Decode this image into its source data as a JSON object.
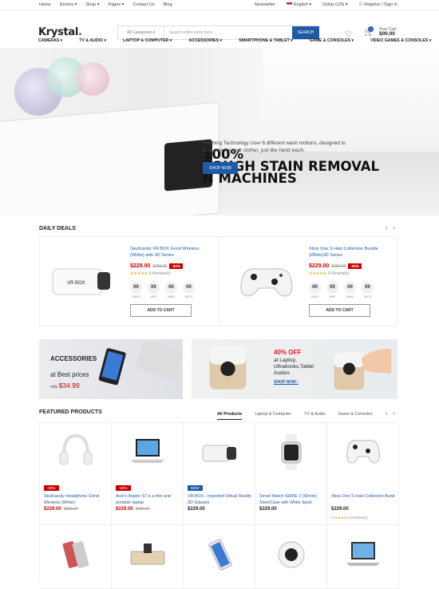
{
  "topbar": {
    "links": [
      "Home",
      "Demos ▾",
      "Shop ▾",
      "Pages ▾",
      "Contact Us",
      "Blog"
    ],
    "newsletter": "Newsletter",
    "language": "English ▾",
    "currency": "Dollar (US) ▾",
    "account": "Register / Sign in"
  },
  "header": {
    "logo": "Krystal",
    "category": "All Categories ▾",
    "search_placeholder": "Search entire store here...",
    "search_button": "SEARCH",
    "cart_label": "Your Cart:",
    "cart_total": "$00.00",
    "cart_count": "0"
  },
  "menu": [
    "CAMERAS ▾",
    "TV & AUDIO ▾",
    "LAPTOP & COMPUTER ▾",
    "ACCESSORIES ▾",
    "SMARTPHONE & TABLET ▾",
    "GAME & CONSOLES ▾",
    "VIDEO GAMES & CONSOLES ▾"
  ],
  "hero": {
    "line1": "100%",
    "line2": "TOUGH STAIN REMOVAL",
    "line3": "N MACHINES",
    "sub": "Washing Tachnology User 6 different wash motions, designed to best care for your clother, just like hand wash.",
    "button": "SHOP NOW"
  },
  "daily_deals": {
    "title": "DAILY DEALS",
    "items": [
      {
        "name": "Skullcandy VR BOX Grind Wireless (White) with 3D Series",
        "price": "$229.00",
        "old": "$280.00",
        "off": "-50%",
        "reviews": "5 Review(s)",
        "timer": [
          "00",
          "00",
          "00",
          "00"
        ],
        "units": [
          "DAYS",
          "HRS",
          "MINS",
          "SECS"
        ],
        "button": "ADD TO CART",
        "img_text": "VR BOX"
      },
      {
        "name": "Xbox One S Halo Collection Bundle (White)3D Series",
        "price": "$229.00",
        "old": "$280.00",
        "off": "-50%",
        "reviews": "5 Review(s)",
        "timer": [
          "00",
          "00",
          "00",
          "00"
        ],
        "units": [
          "DAYS",
          "HRS",
          "MINS",
          "SECS"
        ],
        "button": "ADD TO CART"
      }
    ]
  },
  "banners": {
    "b1": {
      "title": "ACCESSORIES",
      "sub": "at Best prices",
      "only": "only",
      "price": "$34.99"
    },
    "b2": {
      "off": "40% OFF",
      "text": "at Laptop, Ultrabooks,Tablet Audios",
      "link": "SHOP NOW ›"
    }
  },
  "featured": {
    "title": "FEATURED PRODUCTS",
    "tabs": [
      "All Products",
      "Laptop & Computer",
      "TV & Audio",
      "Game & Consoles"
    ],
    "products": [
      {
        "name": "Skullcandy Headphone Grind Wireless (White)",
        "price": "$229.00",
        "old": "$280.00",
        "badge": "-50%",
        "badge_color": "#c00"
      },
      {
        "name": "Acer's Aspire S7 is a thin and portable laptop",
        "price": "$229.00",
        "old": "$280.00",
        "badge": "-50%",
        "badge_color": "#c00"
      },
      {
        "name": "VR-BOX - Imported Virtual Reality 3D Glasses",
        "price": "$229.00",
        "old": "",
        "badge": "NEW",
        "badge_color": "#1e5aa6"
      },
      {
        "name": "Smart Watch SERIE 2 (42mm) SilverCase with White Sport",
        "price": "$229.00",
        "old": "",
        "badge": "",
        "badge_color": ""
      },
      {
        "name": "Xbox One S Halo Collection Bund",
        "price": "$229.00",
        "old": "",
        "badge": "",
        "badge_color": "",
        "reviews": "5 Review(s)"
      }
    ]
  }
}
